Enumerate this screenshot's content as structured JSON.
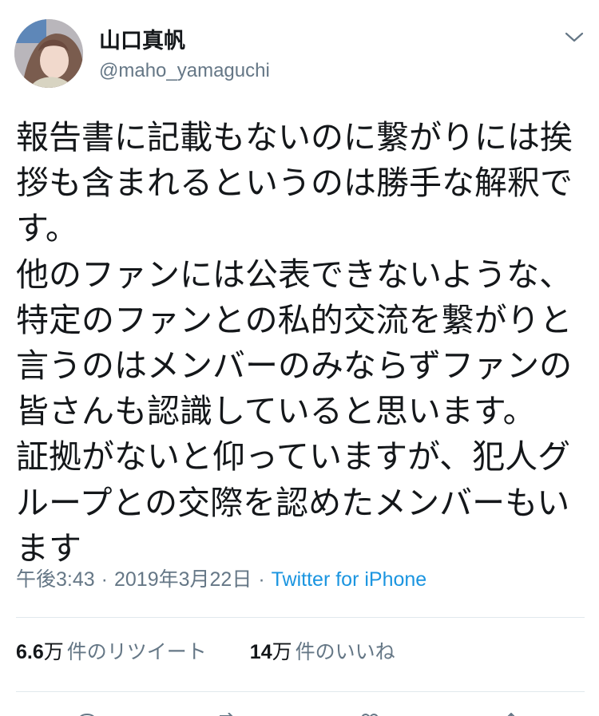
{
  "user": {
    "display_name": "山口真帆",
    "handle": "@maho_yamaguchi"
  },
  "tweet": {
    "text": "報告書に記載もないのに繋がりには挨\n拶も含まれるというのは勝手な解釈で\nす。\n他のファンには公表できないような、\n特定のファンとの私的交流を繋がりと\n言うのはメンバーのみならずファンの\n皆さんも認識していると思います。\n証拠がないと仰っていますが、犯人グ\nループとの交際を認めたメンバーもい\nます",
    "time": "午後3:43",
    "date": "2019年3月22日",
    "separator": "·",
    "source": "Twitter for iPhone"
  },
  "stats": {
    "retweets": {
      "number": "6.6",
      "unit": "万",
      "label": "件のリツイート"
    },
    "likes": {
      "number": "14",
      "unit": "万",
      "label": "件のいいね"
    }
  },
  "colors": {
    "text": "#14171a",
    "secondary": "#657786",
    "link": "#1b95e0",
    "divider": "#e1e8ed"
  },
  "icons": {
    "menu": "chevron-down-icon",
    "actions": [
      "reply-icon",
      "retweet-icon",
      "like-icon",
      "share-icon"
    ]
  }
}
